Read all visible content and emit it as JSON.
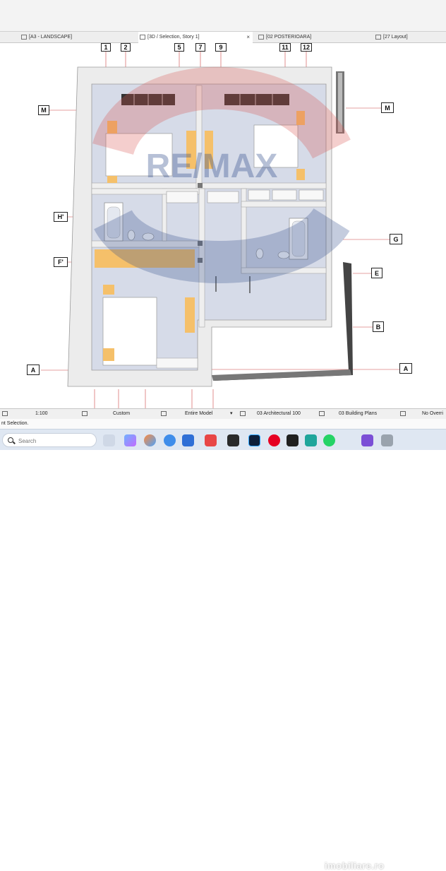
{
  "tabs": [
    {
      "label": "[A3 - LANDSCAPE]",
      "icon": "layout-sheet-icon"
    },
    {
      "label": "[3D / Selection, Story 1]",
      "icon": "3d-window-icon",
      "active": true,
      "close": "×"
    },
    {
      "label": "[02 POSTERIOARA]",
      "icon": "elevation-icon"
    },
    {
      "label": "[27 Layout]",
      "icon": "layout-sheet-icon"
    }
  ],
  "grid_markers": {
    "top": [
      "1",
      "2",
      "5",
      "7",
      "9",
      "11",
      "12"
    ],
    "left": [
      "M",
      "H'",
      "F'",
      "A"
    ],
    "right": [
      "M",
      "G",
      "E",
      "B",
      "A"
    ]
  },
  "watermark_text": "RE/MAX",
  "statusbar": {
    "scale": "1:100",
    "zoom_option": "Custom",
    "model_view": "Entire Model",
    "layer_combo": "03 Architectural 100",
    "view_combo": "03 Building Plans",
    "override": "No Overri"
  },
  "status_message": "nt Selection.",
  "taskbar": {
    "search_placeholder": "Search",
    "site_watermark": "imobiliare.ro"
  },
  "colors": {
    "wall": "#e8e8e8",
    "furniture": "#f5c06a",
    "floor": "#d6dbe8",
    "remax_red": "#d9534f",
    "remax_blue": "#2f4b8a"
  }
}
